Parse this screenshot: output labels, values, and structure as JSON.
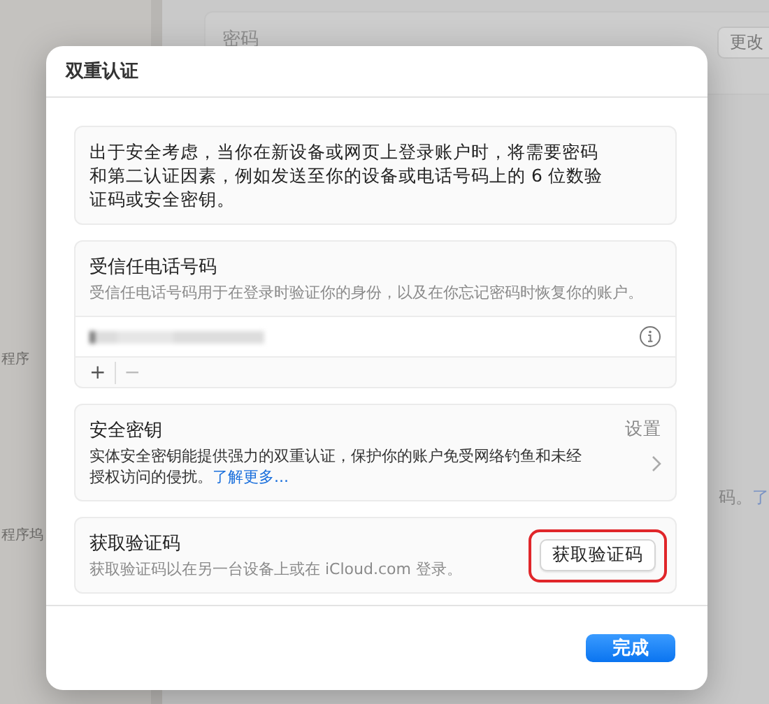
{
  "background": {
    "sidebar_fragments": [
      "程序",
      "程序坞"
    ],
    "password_label": "密码",
    "change_button": "更改",
    "fragment_text": "码。",
    "fragment_link": "了"
  },
  "dialog": {
    "title": "双重认证",
    "intro": "出于安全考虑，当你在新设备或网页上登录账户时，将需要密码和第二认证因素，例如发送至你的设备或电话号码上的 6 位数验证码或安全密钥。",
    "trusted_phone": {
      "title": "受信任电话号码",
      "description": "受信任电话号码用于在登录时验证你的身份，以及在你忘记密码时恢复你的账户。",
      "add": "+",
      "remove": "−"
    },
    "security_key": {
      "title": "安全密钥",
      "description": "实体安全密钥能提供强力的双重认证，保护你的账户免受网络钓鱼和未经授权访问的侵扰。",
      "link": "了解更多...",
      "action": "设置"
    },
    "get_code": {
      "title": "获取验证码",
      "description": "获取验证码以在另一台设备上或在 iCloud.com 登录。",
      "button": "获取验证码",
      "highlighted": true
    },
    "done_button": "完成"
  }
}
